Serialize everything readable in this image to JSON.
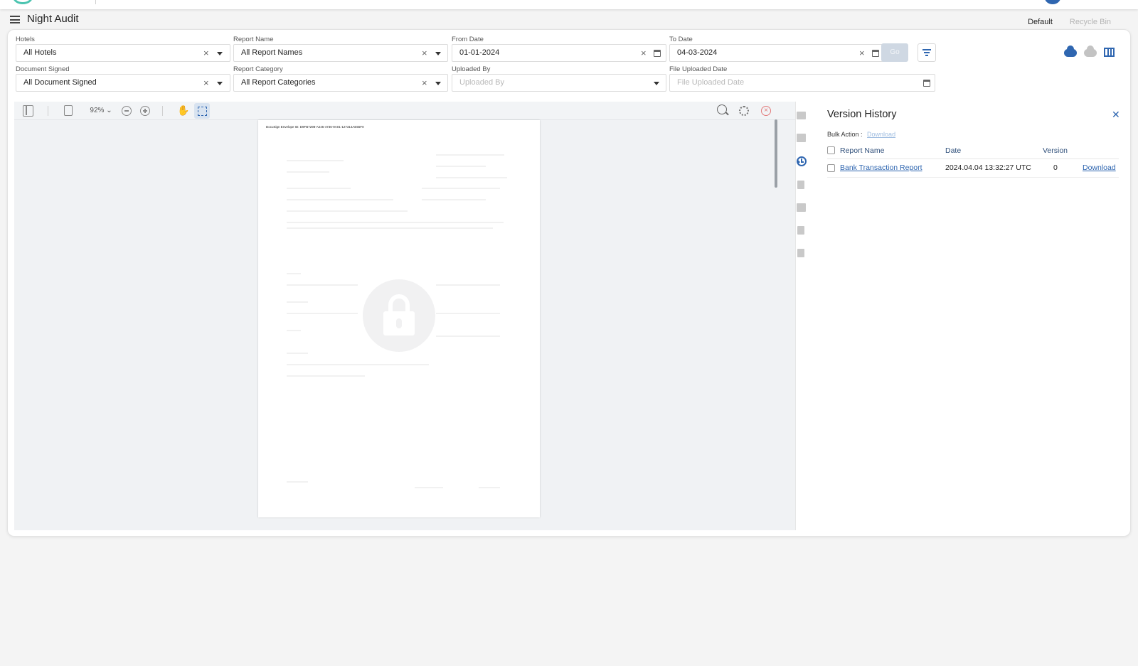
{
  "app": {
    "page_title": "Night Audit"
  },
  "view_tabs": [
    {
      "label": "Default",
      "active": true
    },
    {
      "label": "Recycle Bin",
      "active": false
    }
  ],
  "filters": {
    "hotels": {
      "label": "Hotels",
      "value": "All Hotels"
    },
    "report_name": {
      "label": "Report Name",
      "value": "All Report Names"
    },
    "from_date": {
      "label": "From Date",
      "value": "01-01-2024"
    },
    "to_date": {
      "label": "To Date",
      "value": "04-03-2024"
    },
    "document_signed": {
      "label": "Document Signed",
      "value": "All Document Signed"
    },
    "report_category": {
      "label": "Report Category",
      "value": "All Report Categories"
    },
    "uploaded_by": {
      "label": "Uploaded By",
      "placeholder": "Uploaded By"
    },
    "file_uploaded_date": {
      "label": "File Uploaded Date",
      "placeholder": "File Uploaded Date"
    },
    "go_label": "Go"
  },
  "viewer": {
    "zoom": "92%",
    "envelope_id": "DocuSign Envelope ID: D9FB7298-A245-4736-9A01-127314AE55F0"
  },
  "version_history": {
    "title": "Version History",
    "bulk_action_label": "Bulk Action :",
    "bulk_download": "Download",
    "columns": [
      "Report Name",
      "Date",
      "Version"
    ],
    "rows": [
      {
        "report_name": "Bank Transaction Report",
        "date": "2024.04.04 13:32:27 UTC",
        "version": "0",
        "action": "Download"
      }
    ]
  },
  "icons": [
    "menu-icon",
    "cloud-upload-icon",
    "cloud-download-icon",
    "columns-icon",
    "filter-icon",
    "folder-icon",
    "edit-icon",
    "history-icon",
    "upload-icon",
    "share-icon",
    "file-icon",
    "trash-icon",
    "lock-icon"
  ],
  "colors": {
    "accent": "#2f66b0",
    "tab_underline": "#e8b04a",
    "go_button": "#cfd8e3"
  }
}
